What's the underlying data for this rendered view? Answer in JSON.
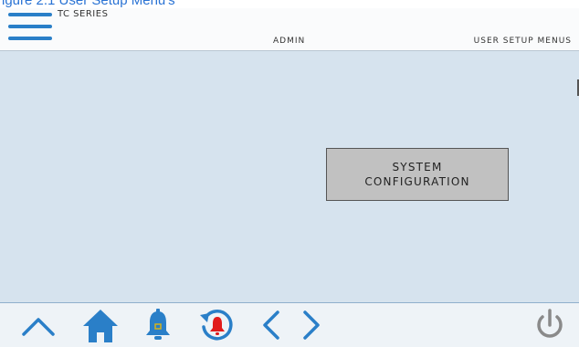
{
  "caption": {
    "text": "igure 2.1 User Setup Menu's"
  },
  "header": {
    "series": "TC SERIES",
    "user": "ADMIN",
    "screen_title": "USER SETUP MENUS"
  },
  "main": {
    "system_config_line1": "SYSTEM",
    "system_config_line2": "CONFIGURATION"
  },
  "footer": {
    "icons": [
      "chevron-up-icon",
      "home-icon",
      "bell-icon",
      "alarm-history-icon",
      "chevron-left-icon",
      "chevron-right-icon",
      "power-icon"
    ]
  },
  "colors": {
    "accent_blue": "#2a7fc8",
    "alarm_red": "#e11b1b",
    "bell_yellow": "#d4b21a",
    "screen_bg": "#d6e3ee",
    "button_gray": "#c1c1c1"
  }
}
